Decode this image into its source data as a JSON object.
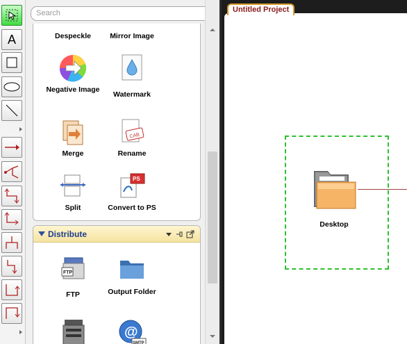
{
  "search": {
    "placeholder": "Search"
  },
  "tools_group": {
    "items": [
      {
        "label": "Despeckle"
      },
      {
        "label": "Mirror Image"
      },
      {
        "label": "Negative Image"
      },
      {
        "label": "Watermark"
      },
      {
        "label": "Merge"
      },
      {
        "label": "Rename"
      },
      {
        "label": "Split"
      },
      {
        "label": "Convert to PS"
      }
    ]
  },
  "distribute_group": {
    "title": "Distribute",
    "items": [
      {
        "label": "FTP"
      },
      {
        "label": "Output Folder"
      },
      {
        "label": ""
      },
      {
        "label": ""
      }
    ]
  },
  "project": {
    "tab_title": "Untitled Project",
    "node_label": "Desktop"
  },
  "colors": {
    "accent": "#1f3d8c",
    "selection": "#2fbf2f",
    "tab_border": "#d49b2a"
  }
}
